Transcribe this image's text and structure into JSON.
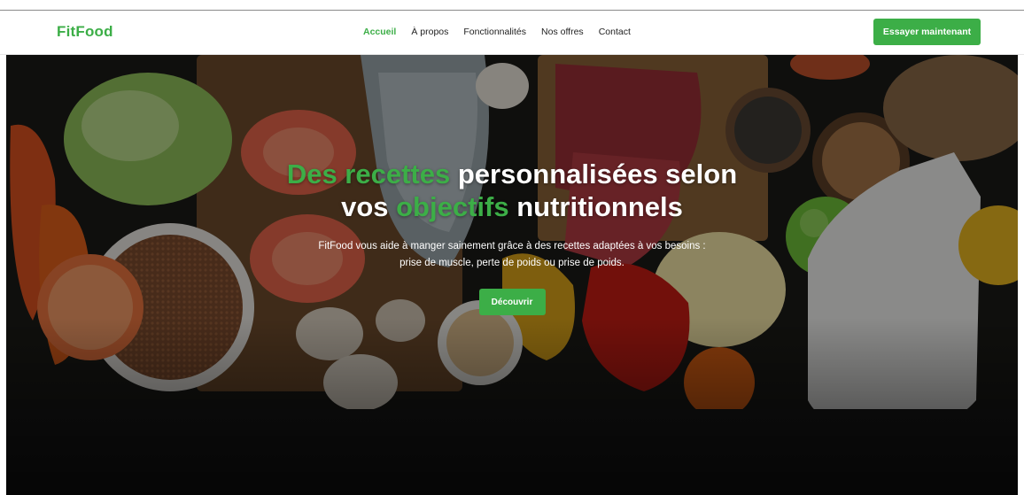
{
  "brand": {
    "name": "FitFood",
    "color": "#3cae47"
  },
  "nav": {
    "links": [
      {
        "label": "Accueil",
        "active": true
      },
      {
        "label": "À propos",
        "active": false
      },
      {
        "label": "Fonctionnalités",
        "active": false
      },
      {
        "label": "Nos offres",
        "active": false
      },
      {
        "label": "Contact",
        "active": false
      }
    ],
    "cta_label": "Essayer maintenant"
  },
  "hero": {
    "title_parts": [
      {
        "text": "Des recettes",
        "highlight": true
      },
      {
        "text": " personnalisées selon vos ",
        "highlight": false
      },
      {
        "text": "objectifs",
        "highlight": true
      },
      {
        "text": " nutritionnels",
        "highlight": false
      }
    ],
    "subtitle_line1": "FitFood vous aide à manger sainement grâce à des recettes adaptées à vos besoins :",
    "subtitle_line2": "prise de muscle, perte de poids ou prise de poids.",
    "button_label": "Découvrir",
    "background_image": "food-ingredients-photo"
  },
  "colors": {
    "accent": "#3cae47",
    "text_light": "#ffffff",
    "nav_text": "#222222"
  }
}
